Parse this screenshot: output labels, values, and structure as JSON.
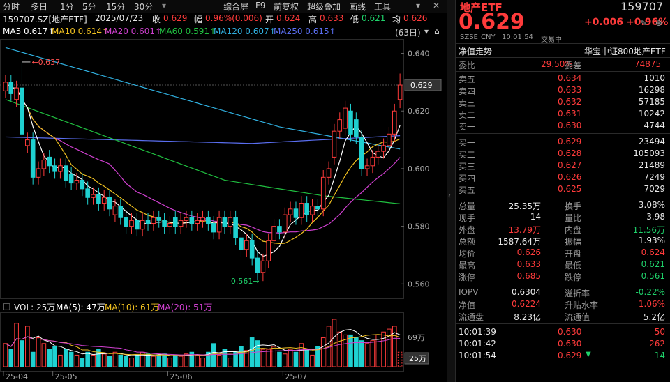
{
  "toolbar": {
    "items": [
      "分时",
      "多日",
      "1分",
      "5分",
      "15分",
      "30分",
      "综合屏",
      "F9",
      "前复权",
      "超级叠加",
      "画线",
      "工具"
    ]
  },
  "title": {
    "code_name": "159707.SZ[地产ETF]",
    "date": "2025/07/23",
    "close_label": "收",
    "close": "0.629",
    "chg_label": "幅",
    "chg": "0.96%(0.006)",
    "open_label": "开",
    "open": "0.624",
    "high_label": "高",
    "high": "0.633",
    "low_label": "低",
    "low": "0.621",
    "avg_label": "均",
    "avg": "0.626"
  },
  "ma": {
    "ma5": "MA5 0.617↑",
    "ma10": "MA10 0.614↑",
    "ma20": "MA20 0.601↑",
    "ma60": "MA60 0.591↑",
    "ma120": "MA120 0.607↑",
    "ma250": "MA250 0.615↑",
    "period": "(63日)"
  },
  "colors": {
    "up": "#ff3b3b",
    "down": "#1fd1d1",
    "ma5": "#ffffff",
    "ma10": "#f0c020",
    "ma20": "#d040d0",
    "ma60": "#20c040",
    "ma120": "#30b0e0",
    "ma250": "#5a6ef0"
  },
  "price_axis": {
    "ticks": [
      "0.640",
      "0.620",
      "0.600",
      "0.580",
      "0.560"
    ],
    "current": "0.629"
  },
  "annotations": {
    "high": "0.637",
    "low": "0.561"
  },
  "volume": {
    "label": "VOL: 25万",
    "ma5": "MA(5): 47万",
    "ma10": "MA(10): 61万",
    "ma20": "MA(20): 51万",
    "axis_top": "69万",
    "axis_current": "25万"
  },
  "xaxis": {
    "labels": [
      "25-04",
      "25-05",
      "25-06",
      "25-07"
    ]
  },
  "quote": {
    "name": "地产ETF",
    "price": "0.629",
    "code": "159707",
    "chg": "+0.006",
    "pct": "+0.96%",
    "exchange": "SZSE",
    "currency": "CNY",
    "time": "10:01:54",
    "status": "交易中",
    "nav_trend": "净值走势",
    "index_name": "华宝中证800地产ETF",
    "weibi_label": "委比",
    "weibi": "29.50%",
    "weicha_label": "委差",
    "weicha": "74875",
    "sell": [
      {
        "label": "卖五",
        "price": "0.634",
        "vol": "1010"
      },
      {
        "label": "卖四",
        "price": "0.633",
        "vol": "16298"
      },
      {
        "label": "卖三",
        "price": "0.632",
        "vol": "57185"
      },
      {
        "label": "卖二",
        "price": "0.631",
        "vol": "10242"
      },
      {
        "label": "卖一",
        "price": "0.630",
        "vol": "4744"
      }
    ],
    "buy": [
      {
        "label": "买一",
        "price": "0.629",
        "vol": "23494"
      },
      {
        "label": "买二",
        "price": "0.628",
        "vol": "105093"
      },
      {
        "label": "买三",
        "price": "0.627",
        "vol": "21489"
      },
      {
        "label": "买四",
        "price": "0.626",
        "vol": "7249"
      },
      {
        "label": "买五",
        "price": "0.625",
        "vol": "7029"
      }
    ],
    "stats": [
      {
        "l1": "总量",
        "v1": "25.35万",
        "c1": "white",
        "l2": "换手",
        "v2": "3.08%",
        "c2": "white"
      },
      {
        "l1": "现手",
        "v1": "14",
        "c1": "white",
        "l2": "量比",
        "v2": "3.98",
        "c2": "white"
      },
      {
        "l1": "外盘",
        "v1": "13.79万",
        "c1": "red",
        "l2": "内盘",
        "v2": "11.56万",
        "c2": "green"
      },
      {
        "l1": "总额",
        "v1": "1587.64万",
        "c1": "white",
        "l2": "振幅",
        "v2": "1.93%",
        "c2": "white"
      },
      {
        "l1": "均价",
        "v1": "0.626",
        "c1": "red",
        "l2": "开盘",
        "v2": "0.624",
        "c2": "red"
      },
      {
        "l1": "最高",
        "v1": "0.633",
        "c1": "red",
        "l2": "最低",
        "v2": "0.621",
        "c2": "green"
      },
      {
        "l1": "涨停",
        "v1": "0.685",
        "c1": "red",
        "l2": "跌停",
        "v2": "0.561",
        "c2": "green"
      }
    ],
    "iopv": [
      {
        "l1": "IOPV",
        "v1": "0.6304",
        "c1": "white",
        "l2": "溢折率",
        "v2": "-0.22%",
        "c2": "green"
      },
      {
        "l1": "净值",
        "v1": "0.6224",
        "c1": "red",
        "l2": "升贴水率",
        "v2": "1.06%",
        "c2": "red"
      },
      {
        "l1": "流通盘",
        "v1": "8.23亿",
        "c1": "white",
        "l2": "流通值",
        "v2": "5.2亿",
        "c2": "white"
      }
    ],
    "ticks": [
      {
        "time": "10:01:39",
        "price": "0.630",
        "vol": "50"
      },
      {
        "time": "10:01:42",
        "price": "0.630",
        "vol": "262"
      },
      {
        "time": "10:01:54",
        "price": "0.629",
        "vol": "14"
      }
    ]
  }
}
